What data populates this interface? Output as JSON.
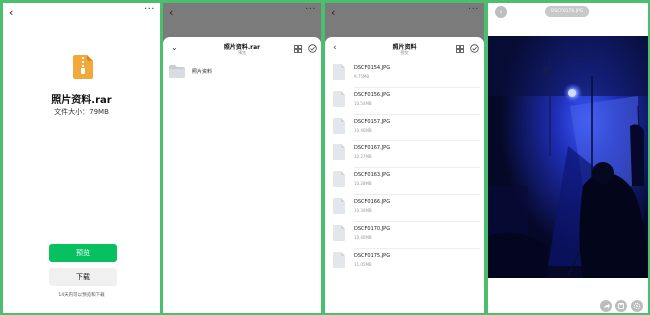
{
  "panel1": {
    "back_glyph": "‹",
    "more_glyph": "···",
    "file_name": "照片资料.rar",
    "file_size": "文件大小：79MB",
    "preview_label": "预览",
    "download_label": "下载",
    "download_note": "14天内可以预览和下载"
  },
  "panel2": {
    "back_glyph": "‹",
    "more_glyph": "···",
    "title": "照片资料.rar",
    "subtitle": "预览",
    "collapse_glyph": "⌄",
    "folder_label": "照片资料"
  },
  "panel3": {
    "back_glyph": "‹",
    "more_glyph": "···",
    "title": "照片资料",
    "subtitle": "预览",
    "files": [
      {
        "name": "DSCF0154.JPG",
        "size": "9.75MB"
      },
      {
        "name": "DSCF0156.JPG",
        "size": "10.54MB"
      },
      {
        "name": "DSCF0157.JPG",
        "size": "10.46MB"
      },
      {
        "name": "DSCF0167.JPG",
        "size": "10.27MB"
      },
      {
        "name": "DSCF0163.JPG",
        "size": "10.28MB"
      },
      {
        "name": "DSCF0166.JPG",
        "size": "10.30MB"
      },
      {
        "name": "DSCF0170.JPG",
        "size": "10.40MB"
      },
      {
        "name": "DSCF0175.JPG",
        "size": "11.05MB"
      }
    ]
  },
  "panel4": {
    "back_glyph": "‹",
    "file_name": "DSCF0176.JPG"
  },
  "colors": {
    "frame": "#4cbf6f",
    "primary_button": "#07c160",
    "overlay": "#7b7b7b"
  },
  "icons": {
    "zip": "zip-file-icon",
    "folder": "folder-icon",
    "document": "document-icon",
    "grid": "grid-view-icon",
    "select": "check-circle-icon",
    "share": "share-icon",
    "save": "save-icon",
    "settings": "settings-icon"
  }
}
